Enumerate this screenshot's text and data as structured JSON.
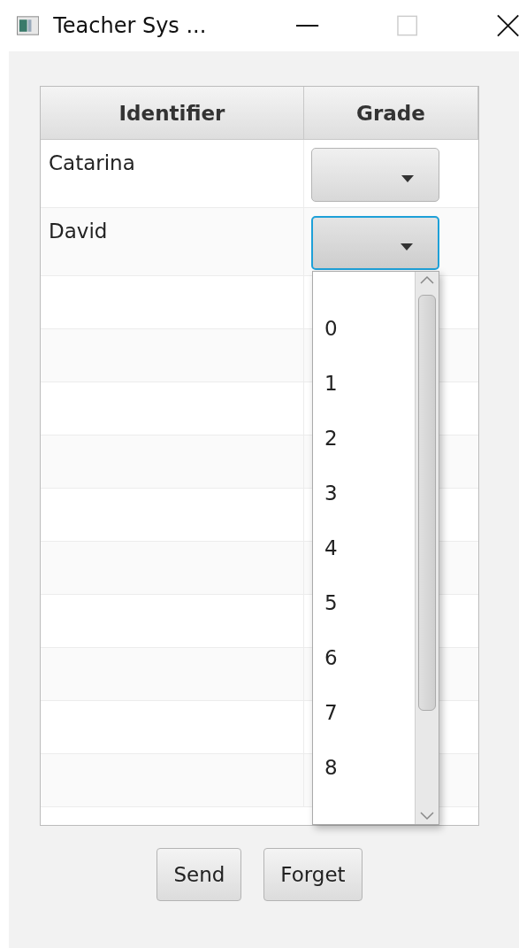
{
  "window": {
    "title": "Teacher Sys ...",
    "maximize_disabled": true
  },
  "table": {
    "columns": [
      "Identifier",
      "Grade"
    ],
    "rows": [
      {
        "identifier": "Catarina",
        "grade_focused": false,
        "grade_open": false
      },
      {
        "identifier": "David",
        "grade_focused": true,
        "grade_open": true
      }
    ]
  },
  "grade_options": [
    "0",
    "1",
    "2",
    "3",
    "4",
    "5",
    "6",
    "7",
    "8"
  ],
  "buttons": [
    "Send",
    "Forget"
  ]
}
